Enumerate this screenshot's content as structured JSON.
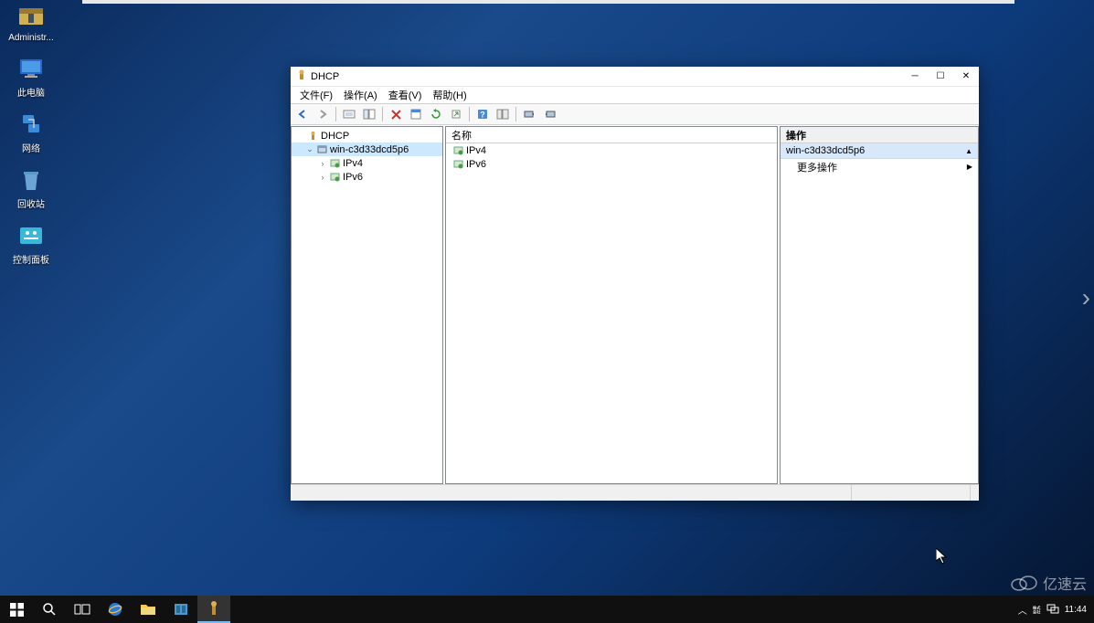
{
  "desktop": {
    "icons": [
      {
        "label": "Administr..."
      },
      {
        "label": "此电脑"
      },
      {
        "label": "网络"
      },
      {
        "label": "回收站"
      },
      {
        "label": "控制面板"
      }
    ]
  },
  "window": {
    "title": "DHCP",
    "menu": {
      "file": "文件(F)",
      "action": "操作(A)",
      "view": "查看(V)",
      "help": "帮助(H)"
    },
    "tree": {
      "root": "DHCP",
      "server": "win-c3d33dcd5p6",
      "ipv4": "IPv4",
      "ipv6": "IPv6"
    },
    "list": {
      "header_name": "名称",
      "items": [
        "IPv4",
        "IPv6"
      ]
    },
    "actions": {
      "header": "操作",
      "selected": "win-c3d33dcd5p6",
      "more": "更多操作"
    }
  },
  "taskbar": {
    "time": "11:44"
  },
  "watermark": "亿速云"
}
